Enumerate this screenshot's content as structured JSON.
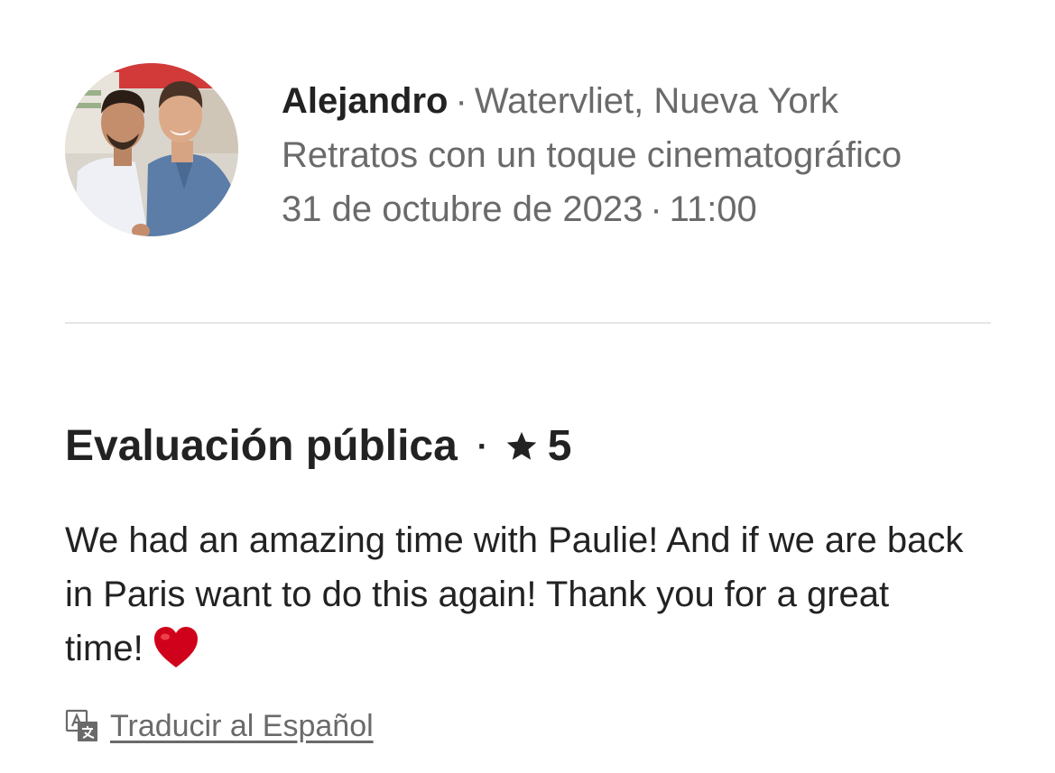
{
  "host": {
    "name": "Alejandro",
    "location": "Watervliet, Nueva York",
    "experience": "Retratos con un toque cinematográfico",
    "date": "31 de octubre de 2023",
    "time": "11:00",
    "separator": "·",
    "avatar_icon": "avatar-photo"
  },
  "review": {
    "heading": "Evaluación pública",
    "separator": "·",
    "rating_icon": "star-icon",
    "rating": "5",
    "body": "We had an amazing time with Paulie! And if we are back in Paris want to do this again! Thank you for a great time!",
    "emoji_icon": "heart-icon",
    "heart_color": "#d0021b"
  },
  "translate": {
    "icon": "translate-icon",
    "label": "Traducir al Español"
  }
}
